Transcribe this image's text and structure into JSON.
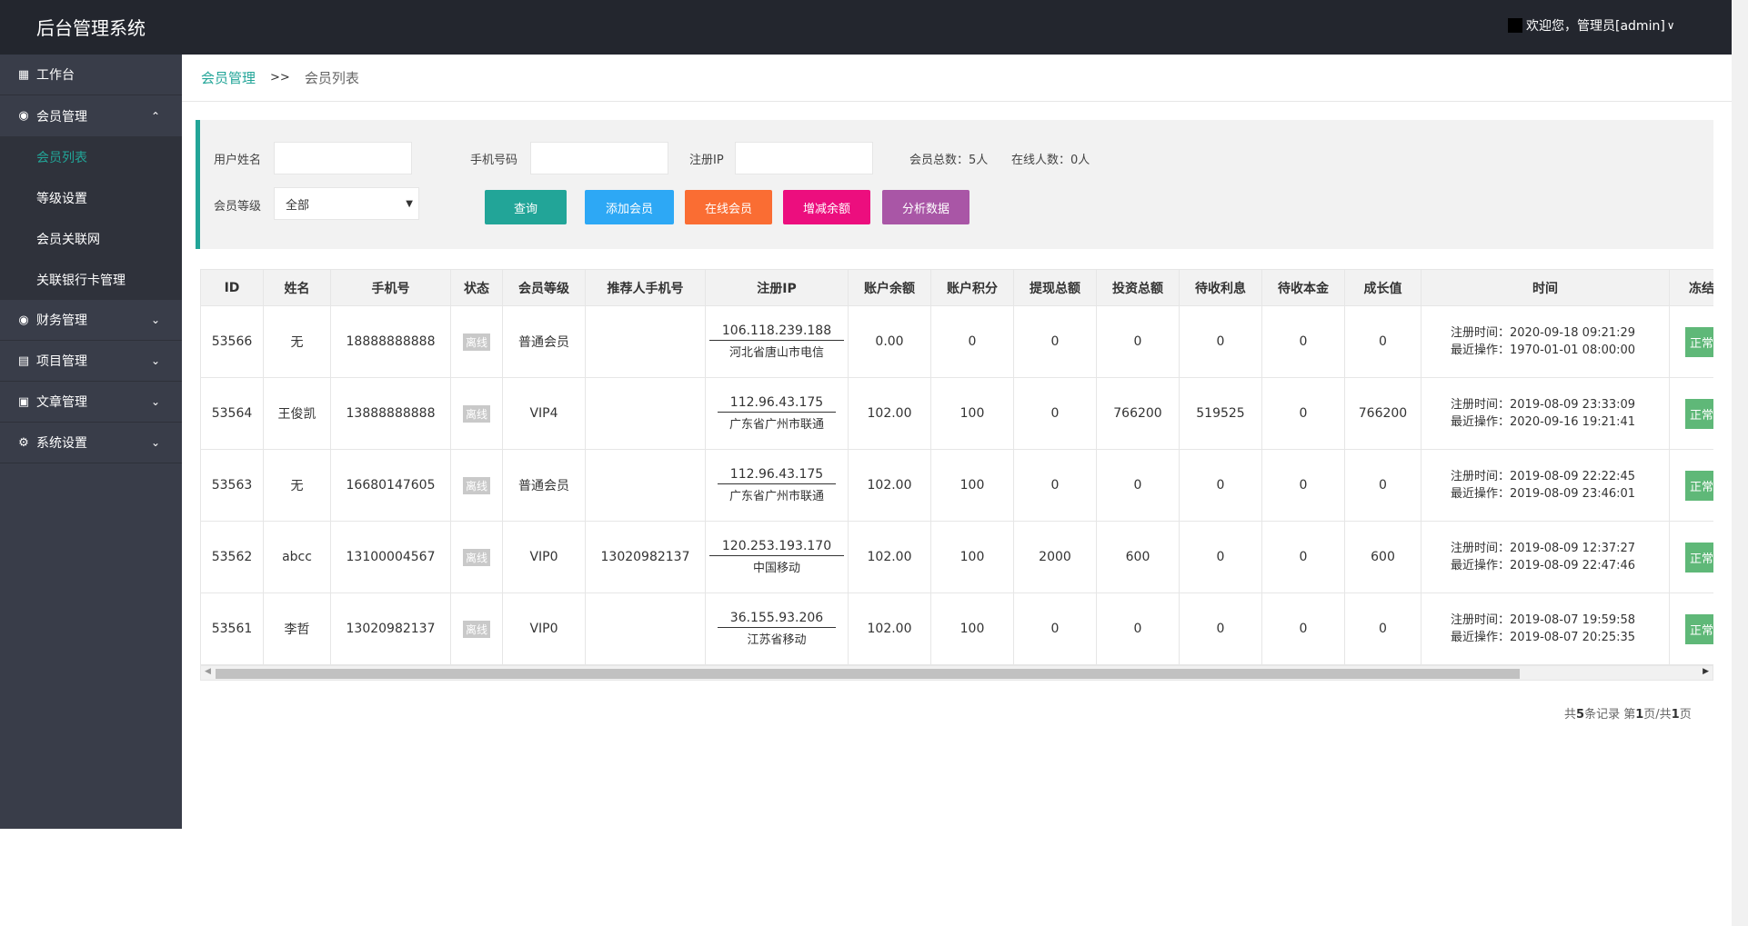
{
  "app": {
    "title": "后台管理系统",
    "welcome": "欢迎您，管理员[admin]"
  },
  "sidebar": {
    "items": [
      {
        "label": "工作台",
        "icon": "dashboard-icon"
      },
      {
        "label": "会员管理",
        "icon": "vip-icon",
        "expanded": true,
        "children": [
          "会员列表",
          "等级设置",
          "会员关联网",
          "关联银行卡管理"
        ],
        "active_child": "会员列表"
      },
      {
        "label": "财务管理",
        "icon": "vip-icon"
      },
      {
        "label": "项目管理",
        "icon": "list-icon"
      },
      {
        "label": "文章管理",
        "icon": "document-icon"
      },
      {
        "label": "系统设置",
        "icon": "gear-icon"
      }
    ]
  },
  "breadcrumb": {
    "parent": "会员管理",
    "separator": ">>",
    "current": "会员列表"
  },
  "filters": {
    "username_label": "用户姓名",
    "username_value": "",
    "phone_label": "手机号码",
    "phone_value": "",
    "ip_label": "注册IP",
    "ip_value": "",
    "total_members": "会员总数：5人",
    "online_count": "在线人数：0人",
    "level_label": "会员等级",
    "level_value": "全部"
  },
  "buttons": {
    "search": "查询",
    "add": "添加会员",
    "online": "在线会员",
    "balance": "增减余额",
    "analyze": "分析数据"
  },
  "colors": {
    "accent": "#22a598",
    "search": "#22a598",
    "add": "#2da8f5",
    "online": "#fa6d33",
    "balance": "#ec0e7e",
    "analyze": "#a956a6",
    "status_ok": "#5fb878"
  },
  "table": {
    "headers": [
      "ID",
      "姓名",
      "手机号",
      "状态",
      "会员等级",
      "推荐人手机号",
      "注册IP",
      "账户余额",
      "账户积分",
      "提现总额",
      "投资总额",
      "待收利息",
      "待收本金",
      "成长值",
      "时间",
      "冻结"
    ],
    "rows": [
      {
        "id": "53566",
        "name": "无",
        "phone": "18888888888",
        "status": "离线",
        "level": "普通会员",
        "referrer": "",
        "ip": "106.118.239.188",
        "ip_location": "河北省唐山市电信",
        "balance": "0.00",
        "points": "0",
        "withdraw": "0",
        "invest": "0",
        "interest": "0",
        "principal": "0",
        "growth": "0",
        "reg_time": "注册时间：2020-09-18 09:21:29",
        "last_op": "最近操作：1970-01-01 08:00:00",
        "freeze": "正常"
      },
      {
        "id": "53564",
        "name": "王俊凯",
        "phone": "13888888888",
        "status": "离线",
        "level": "VIP4",
        "referrer": "",
        "ip": "112.96.43.175",
        "ip_location": "广东省广州市联通",
        "balance": "102.00",
        "points": "100",
        "withdraw": "0",
        "invest": "766200",
        "interest": "519525",
        "principal": "0",
        "growth": "766200",
        "reg_time": "注册时间：2019-08-09 23:33:09",
        "last_op": "最近操作：2020-09-16 19:21:41",
        "freeze": "正常"
      },
      {
        "id": "53563",
        "name": "无",
        "phone": "16680147605",
        "status": "离线",
        "level": "普通会员",
        "referrer": "",
        "ip": "112.96.43.175",
        "ip_location": "广东省广州市联通",
        "balance": "102.00",
        "points": "100",
        "withdraw": "0",
        "invest": "0",
        "interest": "0",
        "principal": "0",
        "growth": "0",
        "reg_time": "注册时间：2019-08-09 22:22:45",
        "last_op": "最近操作：2019-08-09 23:46:01",
        "freeze": "正常"
      },
      {
        "id": "53562",
        "name": "abcc",
        "phone": "13100004567",
        "status": "离线",
        "level": "VIP0",
        "referrer": "13020982137",
        "ip": "120.253.193.170",
        "ip_location": "中国移动",
        "balance": "102.00",
        "points": "100",
        "withdraw": "2000",
        "invest": "600",
        "interest": "0",
        "principal": "0",
        "growth": "600",
        "reg_time": "注册时间：2019-08-09 12:37:27",
        "last_op": "最近操作：2019-08-09 22:47:46",
        "freeze": "正常"
      },
      {
        "id": "53561",
        "name": "李哲",
        "phone": "13020982137",
        "status": "离线",
        "level": "VIP0",
        "referrer": "",
        "ip": "36.155.93.206",
        "ip_location": "江苏省移动",
        "balance": "102.00",
        "points": "100",
        "withdraw": "0",
        "invest": "0",
        "interest": "0",
        "principal": "0",
        "growth": "0",
        "reg_time": "注册时间：2019-08-07 19:59:58",
        "last_op": "最近操作：2019-08-07 20:25:35",
        "freeze": "正常"
      }
    ]
  },
  "pagination": {
    "text1": "共",
    "total": "5",
    "text2": "条记录 ",
    "text3": "第",
    "page": "1",
    "text4": "页/共",
    "pages": "1",
    "text5": "页"
  }
}
